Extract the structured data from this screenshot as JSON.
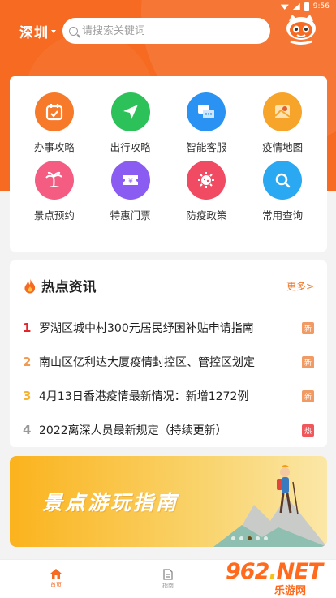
{
  "status_bar": {
    "time": "9:56"
  },
  "header": {
    "city": "深圳",
    "search_placeholder": "请搜索关键词"
  },
  "services": [
    {
      "label": "办事攻略",
      "icon": "calendar-check-icon",
      "color": "#f77a2a"
    },
    {
      "label": "出行攻略",
      "icon": "navigation-arrow-icon",
      "color": "#2cc159"
    },
    {
      "label": "智能客服",
      "icon": "chat-bubble-icon",
      "color": "#2a92f2"
    },
    {
      "label": "疫情地图",
      "icon": "map-location-icon",
      "color": "#f7a52a"
    },
    {
      "label": "景点预约",
      "icon": "palm-tree-icon",
      "color": "#f45c82"
    },
    {
      "label": "特惠门票",
      "icon": "ticket-yen-icon",
      "color": "#8a5cf2"
    },
    {
      "label": "防疫政策",
      "icon": "virus-icon",
      "color": "#f14a63"
    },
    {
      "label": "常用查询",
      "icon": "search-icon",
      "color": "#2aa8f2"
    }
  ],
  "news": {
    "title": "热点资讯",
    "more": "更多>",
    "items": [
      {
        "rank": "1",
        "text": "罗湖区城中村300元居民纾困补贴申请指南",
        "tag": "新",
        "rank_color": "#e5252a",
        "tag_color": "#f29a63"
      },
      {
        "rank": "2",
        "text": "南山区亿利达大厦疫情封控区、管控区划定",
        "tag": "新",
        "rank_color": "#f29a50",
        "tag_color": "#f29a63"
      },
      {
        "rank": "3",
        "text": "4月13日香港疫情最新情况：新增1272例",
        "tag": "新",
        "rank_color": "#f5b233",
        "tag_color": "#f29a63"
      },
      {
        "rank": "4",
        "text": "2022离深人员最新规定（持续更新）",
        "tag": "热",
        "rank_color": "#999999",
        "tag_color": "#f0575a"
      }
    ]
  },
  "banner": {
    "text": "景点游玩指南",
    "slide_index": 3,
    "slide_count": 5
  },
  "tabbar": {
    "tabs": [
      {
        "label": "首页",
        "active": true
      },
      {
        "label": "指南",
        "active": false
      }
    ]
  },
  "watermark": {
    "main_prefix": "962",
    "main_dot": ".",
    "main_suffix": "NET",
    "sub": "乐游网"
  },
  "colors": {
    "brand": "#f66a21",
    "link": "#f37625"
  }
}
